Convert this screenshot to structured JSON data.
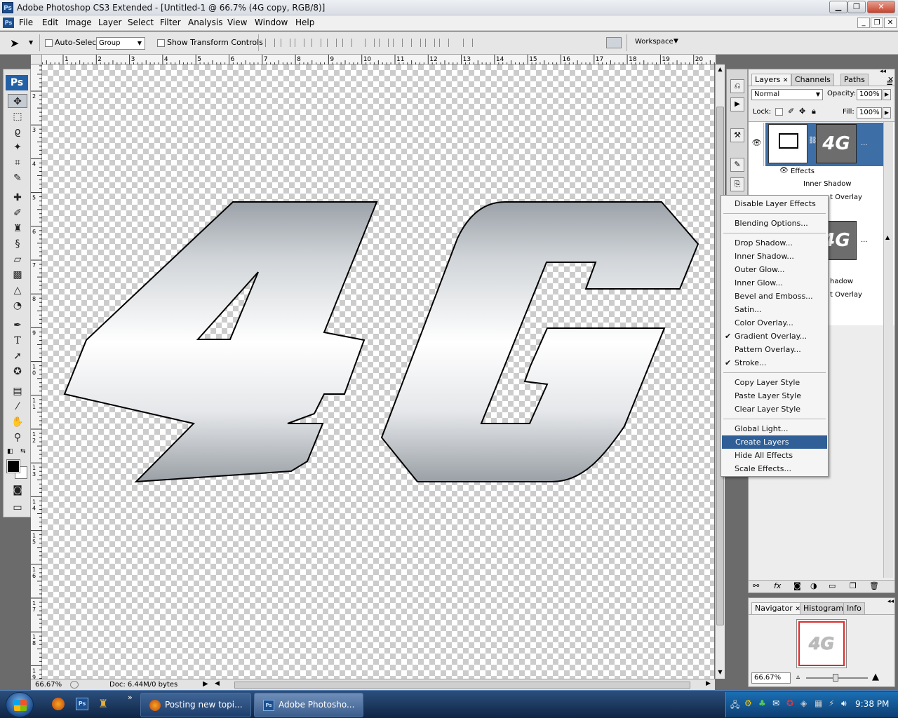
{
  "window": {
    "title": "Adobe Photoshop CS3 Extended - [Untitled-1 @ 66.7% (4G copy, RGB/8)]",
    "app_icon": "Ps"
  },
  "menu": {
    "file": "File",
    "edit": "Edit",
    "image": "Image",
    "layer": "Layer",
    "select": "Select",
    "filter": "Filter",
    "analysis": "Analysis",
    "view": "View",
    "window": "Window",
    "help": "Help"
  },
  "options": {
    "auto_select_label": "Auto-Select:",
    "auto_select_checked": false,
    "auto_select_value": "Group",
    "show_transform_label": "Show Transform Controls",
    "show_transform_checked": false,
    "workspace_label": "Workspace"
  },
  "toolbox": {
    "logo": "Ps"
  },
  "ruler": {
    "top_ticks": [
      "1",
      "2",
      "3",
      "4",
      "5",
      "6",
      "7",
      "8",
      "9",
      "10",
      "11",
      "12",
      "13",
      "14",
      "15",
      "16",
      "17",
      "18",
      "19",
      "20"
    ],
    "left_ticks": [
      "2",
      "3",
      "4",
      "5",
      "6",
      "7",
      "8",
      "9",
      "1\n0",
      "1\n1",
      "1\n2",
      "1\n3",
      "1\n4",
      "1\n5",
      "1\n6",
      "1\n7",
      "1\n8",
      "1\n9"
    ]
  },
  "canvas": {
    "text": "4G"
  },
  "status": {
    "zoom": "66.67%",
    "doc": "Doc: 6.44M/0 bytes"
  },
  "layers_panel": {
    "tabs": [
      "Layers",
      "Channels",
      "Paths"
    ],
    "blend_mode": "Normal",
    "opacity_label": "Opacity:",
    "opacity": "100%",
    "lock_label": "Lock:",
    "fill_label": "Fill:",
    "fill": "100%",
    "layer1": {
      "thumb_text": "4G",
      "effects_label": "Effects",
      "effects": [
        "Inner Shadow",
        "Gradient Overlay"
      ]
    },
    "layer2": {
      "thumb_text": "4G",
      "effects": [
        "Inner Shadow",
        "Gradient Overlay"
      ]
    },
    "effect_tail_1": "t Overlay",
    "effect_tail_2": "hadow",
    "effect_tail_3": "t Overlay"
  },
  "context_menu": {
    "items": [
      {
        "label": "Disable Layer Effects"
      },
      {
        "label": "Blending Options..."
      },
      {
        "label": "Drop Shadow..."
      },
      {
        "label": "Inner Shadow..."
      },
      {
        "label": "Outer Glow..."
      },
      {
        "label": "Inner Glow..."
      },
      {
        "label": "Bevel and Emboss..."
      },
      {
        "label": "Satin..."
      },
      {
        "label": "Color Overlay..."
      },
      {
        "label": "Gradient Overlay...",
        "checked": true
      },
      {
        "label": "Pattern Overlay..."
      },
      {
        "label": "Stroke...",
        "checked": true
      },
      {
        "label": "Copy Layer Style"
      },
      {
        "label": "Paste Layer Style"
      },
      {
        "label": "Clear Layer Style"
      },
      {
        "label": "Global Light..."
      },
      {
        "label": "Create Layers",
        "highlighted": true
      },
      {
        "label": "Hide All Effects"
      },
      {
        "label": "Scale Effects..."
      }
    ],
    "check_glyph": "✔"
  },
  "navigator": {
    "tabs": [
      "Navigator",
      "Histogram",
      "Info"
    ],
    "zoom": "66.67%",
    "thumb_text": "4G"
  },
  "taskbar": {
    "tasks": [
      "Posting new topi...",
      "Adobe Photosho..."
    ],
    "clock": "9:38 PM",
    "overflow": "»"
  },
  "colors": {
    "highlight": "#2f5f96",
    "layer_selected": "#3d6ea5"
  }
}
